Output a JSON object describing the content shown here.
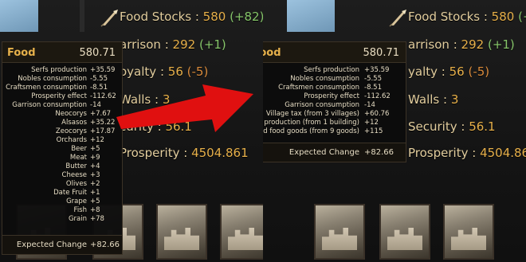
{
  "left": {
    "food_stocks": {
      "label": "Food Stocks :",
      "value": "580",
      "change": "(+82)"
    },
    "garrison": {
      "label": "arrison :",
      "value": "292",
      "change": "(+1)"
    },
    "loyalty": {
      "label": "oyalty :",
      "value": "56",
      "change": "(-5)"
    },
    "walls": {
      "label": "Walls :",
      "value": "3"
    },
    "security": {
      "label": "curity :",
      "value": "56.1"
    },
    "prosperity": {
      "label": "Prosperity :",
      "value": "4504.861"
    },
    "tooltip": {
      "title": "Food",
      "total": "580.71",
      "rows": [
        {
          "label": "Serfs production",
          "value": "+35.59"
        },
        {
          "label": "Nobles consumption",
          "value": "-5.55"
        },
        {
          "label": "Craftsmen consumption",
          "value": "-8.51"
        },
        {
          "label": "Prosperity effect",
          "value": "-112.62"
        },
        {
          "label": "Garrison consumption",
          "value": "-14"
        },
        {
          "label": "Neocorys",
          "value": "+7.67"
        },
        {
          "label": "Alsasos",
          "value": "+35.22"
        },
        {
          "label": "Zeocorys",
          "value": "+17.87"
        },
        {
          "label": "Orchards",
          "value": "+12"
        },
        {
          "label": "Beer",
          "value": "+5"
        },
        {
          "label": "Meat",
          "value": "+9"
        },
        {
          "label": "Butter",
          "value": "+4"
        },
        {
          "label": "Cheese",
          "value": "+3"
        },
        {
          "label": "Olives",
          "value": "+2"
        },
        {
          "label": "Date Fruit",
          "value": "+1"
        },
        {
          "label": "Grape",
          "value": "+5"
        },
        {
          "label": "Fish",
          "value": "+8"
        },
        {
          "label": "Grain",
          "value": "+78"
        }
      ],
      "footer": {
        "label": "Expected Change",
        "value": "+82.66"
      }
    }
  },
  "right": {
    "header_partial": "er",
    "food_stocks": {
      "label": "Food Stocks :",
      "value": "580",
      "change": "(+82)"
    },
    "garrison": {
      "label": "arrison :",
      "value": "292",
      "change": "(+1)"
    },
    "loyalty": {
      "label": "yalty :",
      "value": "56",
      "change": "(-5)"
    },
    "walls": {
      "label": "Walls :",
      "value": "3"
    },
    "security": {
      "label": "Security :",
      "value": "56.1"
    },
    "prosperity": {
      "label": "Prosperity :",
      "value": "4504.861"
    },
    "tooltip": {
      "title": "Food",
      "total": "580.71",
      "rows": [
        {
          "label": "Serfs production",
          "value": "+35.59"
        },
        {
          "label": "Nobles consumption",
          "value": "-5.55"
        },
        {
          "label": "Craftsmen consumption",
          "value": "-8.51"
        },
        {
          "label": "Prosperity effect",
          "value": "-112.62"
        },
        {
          "label": "Garrison consumption",
          "value": "-14"
        },
        {
          "label": "Village tax (from 3 villages)",
          "value": "+60.76"
        },
        {
          "label": "Building production (from 1 building)",
          "value": "+12"
        },
        {
          "label": "Sold food goods (from 9 goods)",
          "value": "+115"
        }
      ],
      "footer": {
        "label": "Expected Change",
        "value": "+82.66"
      }
    }
  },
  "colors": {
    "gold": "#e7b04a",
    "label": "#e2cd9d",
    "positive": "#86c56a",
    "negative": "#d98b3c",
    "arrow": "#e01010"
  }
}
